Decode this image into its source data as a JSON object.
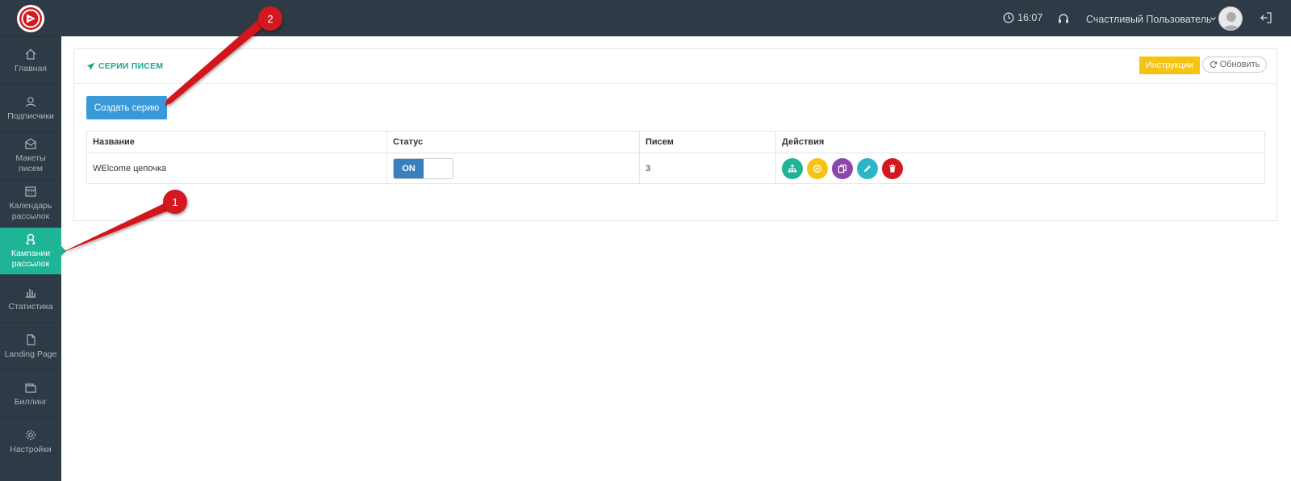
{
  "topbar": {
    "time": "16:07",
    "user_name": "Счастливый Пользователь"
  },
  "sidebar": {
    "items": [
      {
        "label": "Главная",
        "icon": "home-icon"
      },
      {
        "label": "Подписчики",
        "icon": "users-icon"
      },
      {
        "label": "Макеты\nписем",
        "icon": "envelope-icon"
      },
      {
        "label": "Календарь\nрассылок",
        "icon": "calendar-icon"
      },
      {
        "label": "Кампании\nрассылок",
        "icon": "campaign-icon",
        "active": true
      },
      {
        "label": "Статистика",
        "icon": "bar-chart-icon"
      },
      {
        "label": "Landing Page",
        "icon": "file-icon"
      },
      {
        "label": "Биллинг",
        "icon": "wallet-icon"
      },
      {
        "label": "Настройки",
        "icon": "gear-icon"
      }
    ]
  },
  "panel": {
    "title": "СЕРИИ ПИСЕМ",
    "instructions_label": "Инструкции",
    "refresh_label": "Обновить",
    "create_label": "Создать серию"
  },
  "table": {
    "headers": [
      "Название",
      "Статус",
      "Писем",
      "Действия"
    ],
    "rows": [
      {
        "name": "WElcome цепочка",
        "status": "ON",
        "letters": "3"
      }
    ],
    "actions": [
      {
        "icon": "sitemap-icon",
        "color": "#1fb497"
      },
      {
        "icon": "target-icon",
        "color": "#f5c314"
      },
      {
        "icon": "copy-icon",
        "color": "#8e44ad"
      },
      {
        "icon": "pencil-icon",
        "color": "#2ab6c8"
      },
      {
        "icon": "trash-icon",
        "color": "#d3181f"
      }
    ]
  },
  "annotations": {
    "marker_1": "1",
    "marker_2": "2"
  },
  "colors": {
    "sidebar_bg": "#2e3a46",
    "accent_green": "#1fb497",
    "primary_blue": "#3a9ad9",
    "warning_yellow": "#f5c314",
    "annotation_red": "#d3181f"
  }
}
